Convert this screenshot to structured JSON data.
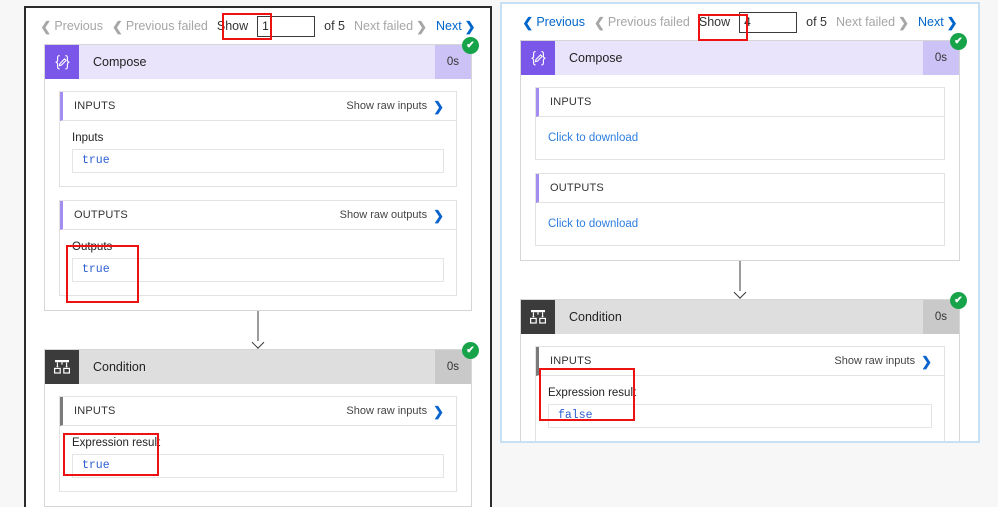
{
  "background_color": "#f7f7f7",
  "accent_colors": {
    "compose_purple": "#7a57e8",
    "compose_header": "#e9e4fb",
    "condition_dark": "#3b3b3b",
    "condition_header": "#dedede",
    "success_green": "#17a34a",
    "link_blue": "#0066cc",
    "value_blue": "#2b5fd0",
    "highlight_red": "#ee1111"
  },
  "left_panel": {
    "pager": {
      "previous_label": "Previous",
      "previous_failed_label": "Previous failed",
      "show_label": "Show",
      "page_value": "1",
      "of_label": "of 5",
      "next_failed_label": "Next failed",
      "next_label": "Next",
      "previous_state": "disabled",
      "previous_failed_state": "disabled",
      "next_failed_state": "disabled",
      "next_state": "active"
    },
    "compose_card": {
      "title": "Compose",
      "duration": "0s",
      "status": "succeeded",
      "icon": "compose-braces-icon",
      "inputs": {
        "section_label": "INPUTS",
        "raw_link": "Show raw inputs",
        "field_label": "Inputs",
        "value": "true"
      },
      "outputs": {
        "section_label": "OUTPUTS",
        "raw_link": "Show raw outputs",
        "field_label": "Outputs",
        "value": "true"
      }
    },
    "condition_card": {
      "title": "Condition",
      "duration": "0s",
      "status": "succeeded",
      "icon": "condition-branch-icon",
      "inputs": {
        "section_label": "INPUTS",
        "raw_link": "Show raw inputs",
        "field_label": "Expression result",
        "value": "true"
      }
    }
  },
  "right_panel": {
    "pager": {
      "previous_label": "Previous",
      "previous_failed_label": "Previous failed",
      "show_label": "Show",
      "page_value": "4",
      "of_label": "of 5",
      "next_failed_label": "Next failed",
      "next_label": "Next",
      "previous_state": "active",
      "previous_failed_state": "disabled",
      "next_failed_state": "disabled",
      "next_state": "active"
    },
    "compose_card": {
      "title": "Compose",
      "duration": "0s",
      "status": "succeeded",
      "icon": "compose-braces-icon",
      "inputs": {
        "section_label": "INPUTS",
        "download_link": "Click to download"
      },
      "outputs": {
        "section_label": "OUTPUTS",
        "download_link": "Click to download"
      }
    },
    "condition_card": {
      "title": "Condition",
      "duration": "0s",
      "status": "succeeded",
      "icon": "condition-branch-icon",
      "inputs": {
        "section_label": "INPUTS",
        "raw_link": "Show raw inputs",
        "field_label": "Expression result",
        "value": "false"
      }
    }
  },
  "badge_glyph": "✔"
}
